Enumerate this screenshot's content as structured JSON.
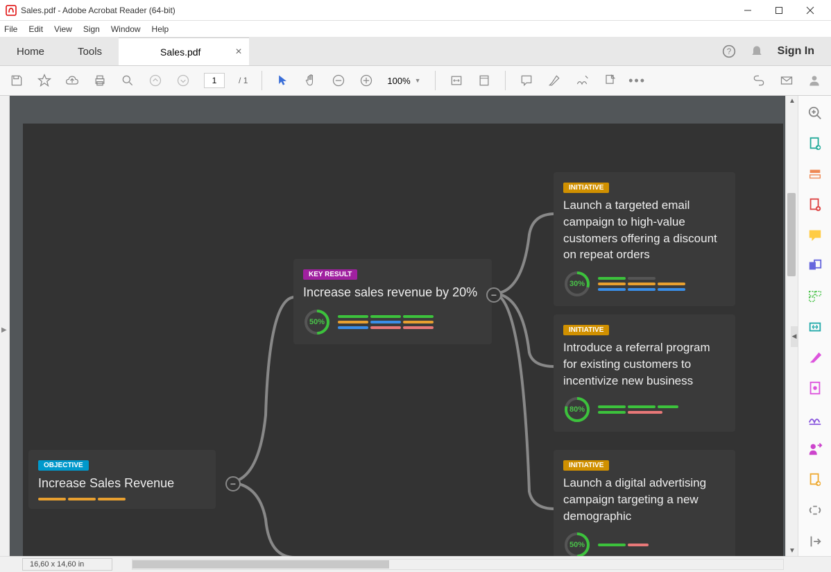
{
  "window": {
    "title": "Sales.pdf - Adobe Acrobat Reader (64-bit)"
  },
  "menu": {
    "file": "File",
    "edit": "Edit",
    "view": "View",
    "sign": "Sign",
    "window": "Window",
    "help": "Help"
  },
  "tabs": {
    "home": "Home",
    "tools": "Tools",
    "document": "Sales.pdf"
  },
  "topright": {
    "signin": "Sign In"
  },
  "toolbar": {
    "page_current": "1",
    "page_sep": "/",
    "page_total": "1",
    "zoom": "100%"
  },
  "status": {
    "dimensions": "16,60 x 14,60 in"
  },
  "doc": {
    "objective": {
      "tag": "OBJECTIVE",
      "title": "Increase Sales Revenue"
    },
    "keyresult": {
      "tag": "KEY RESULT",
      "title": "Increase sales revenue by 20%",
      "pct": "50%"
    },
    "initiative1": {
      "tag": "INITIATIVE",
      "title": "Launch a targeted email campaign to high-value customers offering a discount on repeat orders",
      "pct": "30%"
    },
    "initiative2": {
      "tag": "INITIATIVE",
      "title": "Introduce a referral program for existing customers to incentivize new business",
      "pct": "80%"
    },
    "initiative3": {
      "tag": "INITIATIVE",
      "title": "Launch a digital advertising campaign targeting a new demographic",
      "pct": "50%"
    }
  },
  "colors": {
    "green": "#3cc23c",
    "orange": "#e8a030",
    "blue": "#3a8ee8",
    "pink": "#e87878"
  }
}
